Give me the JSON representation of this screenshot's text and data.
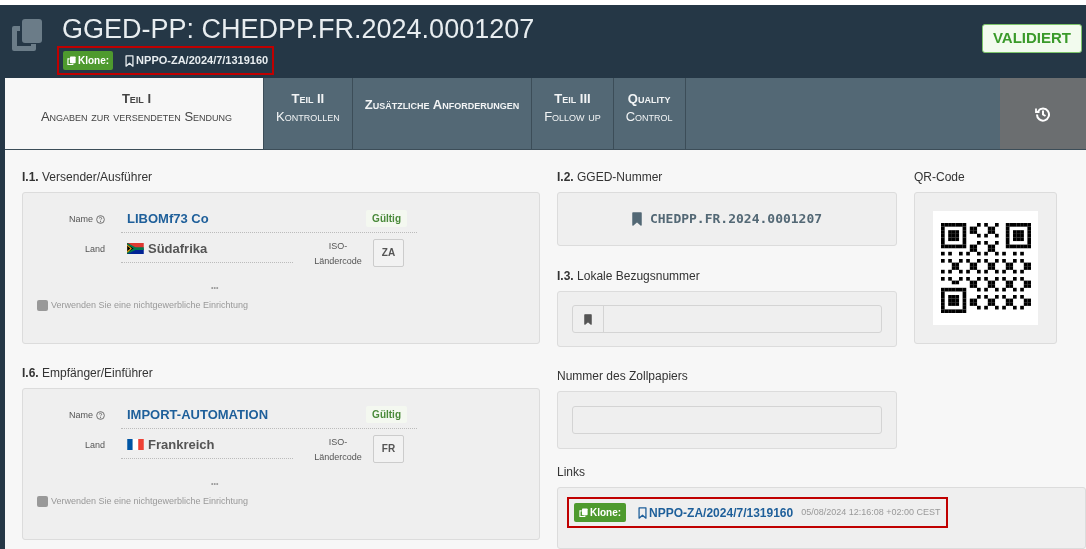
{
  "header": {
    "title": "GGED-PP: CHEDPP.FR.2024.0001207",
    "clone_badge": "Klone:",
    "clone_reference": "NPPO-ZA/2024/7/1319160",
    "highlighted": true,
    "status": "VALIDIERT"
  },
  "tabs": [
    {
      "title": "Teil I",
      "subtitle": "Angaben zur versendeten Sendung",
      "selected": true
    },
    {
      "title": "Teil II",
      "subtitle": "Kontrollen",
      "selected": false
    },
    {
      "title": "Zusätzliche Anforderungen",
      "selected": false
    },
    {
      "title": "Teil III",
      "subtitle": "Follow up",
      "selected": false
    },
    {
      "title": "Quality",
      "subtitle": "Control",
      "selected": false
    }
  ],
  "parties": [
    {
      "number": "I.1.",
      "heading": "Versender/Ausführer",
      "name_label": "Name",
      "name": "LIBOMf73 Co",
      "validity": "Gültig",
      "country_label": "Land",
      "flag": {
        "kind": "za"
      },
      "country": "Südafrika",
      "iso_label": "ISO-Ländercode",
      "iso_code": "ZA",
      "more": "•••",
      "checkbox_label": "Verwenden Sie eine nichtgewerbliche Einrichtung",
      "checked": false
    },
    {
      "number": "I.6.",
      "heading": "Empfänger/Einführer",
      "name_label": "Name",
      "name": "IMPORT-AUTOMATION",
      "validity": "Gültig",
      "country_label": "Land",
      "flag": {
        "kind": "fr"
      },
      "country": "Frankreich",
      "iso_label": "ISO-Ländercode",
      "iso_code": "FR",
      "more": "•••",
      "checkbox_label": "Verwenden Sie eine nichtgewerbliche Einrichtung",
      "checked": false
    }
  ],
  "ged_number": {
    "number": "I.2.",
    "heading": "GGED-Nummer",
    "value": "CHEDPP.FR.2024.0001207"
  },
  "local_reference": {
    "number": "I.3.",
    "heading": "Lokale Bezugsnummer"
  },
  "customs_document": {
    "heading": "Nummer des Zollpapiers"
  },
  "qr": {
    "heading": "QR-Code"
  },
  "links": {
    "heading": "Links",
    "items": [
      {
        "badge": "Klone:",
        "reference": "NPPO-ZA/2024/7/1319160",
        "timestamp": "05/08/2024 12:16:08 +02:00 CEST",
        "highlighted": true
      }
    ]
  }
}
